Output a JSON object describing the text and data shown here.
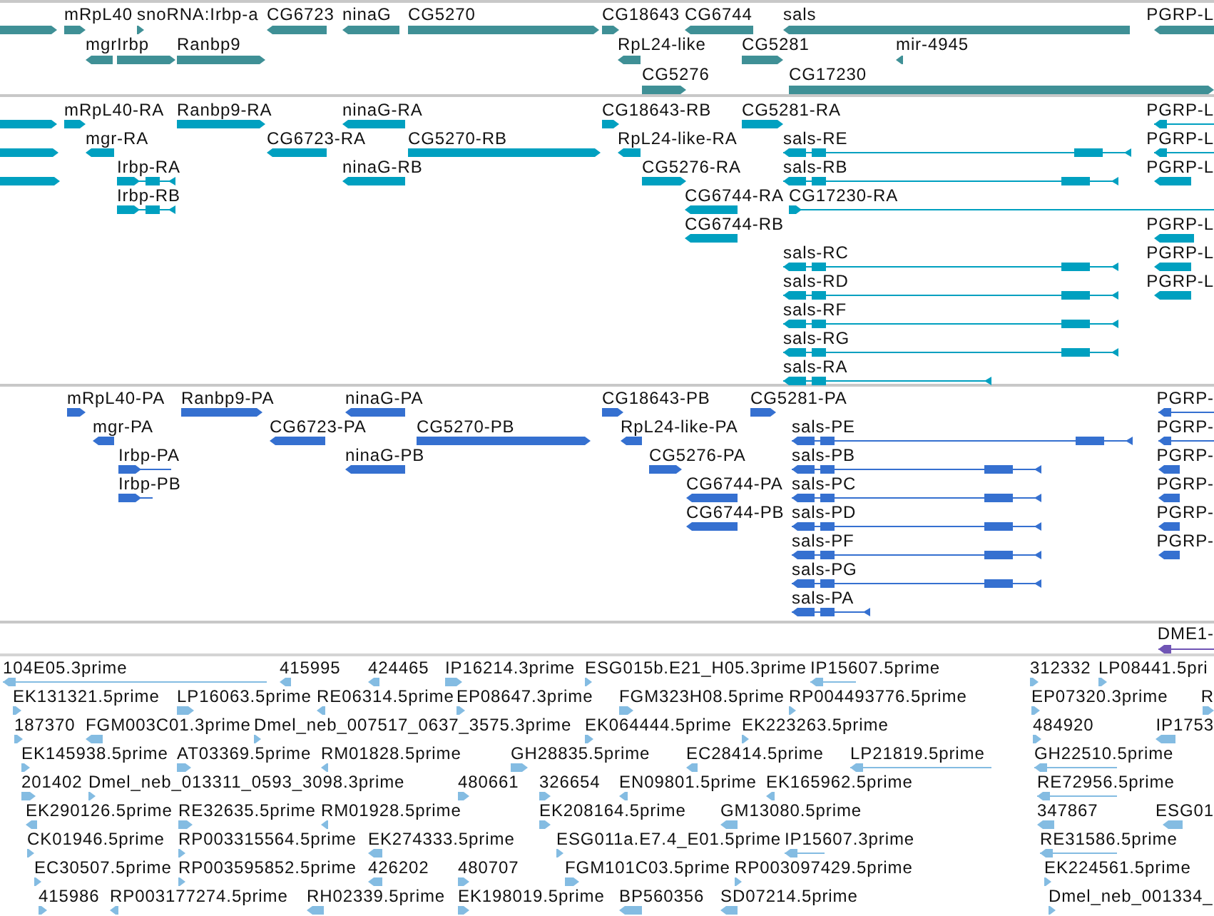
{
  "tracks": [
    {
      "kind": "gene",
      "features": [
        {
          "reverse": false
        },
        {
          "label": "mRpL40",
          "reverse": false
        },
        {
          "label": "snoRNA:Irbp-a",
          "reverse": false
        },
        {
          "label": "CG6723",
          "reverse": true
        },
        {
          "label": "ninaG",
          "reverse": true
        },
        {
          "label": "CG5270",
          "reverse": false
        },
        {
          "label": "CG18643",
          "reverse": false
        },
        {
          "label": "CG6744",
          "reverse": true
        },
        {
          "label": "sals",
          "reverse": true
        },
        {
          "label": "PGRP-L",
          "reverse": true
        },
        {
          "label": "mgr",
          "reverse": true
        },
        {
          "label": "Irbp",
          "reverse": false
        },
        {
          "label": "Ranbp9",
          "reverse": false
        },
        {
          "label": "RpL24-like",
          "reverse": true
        },
        {
          "label": "CG5281",
          "reverse": false
        },
        {
          "label": "mir-4945",
          "reverse": true
        },
        {
          "label": "CG5276",
          "reverse": false
        },
        {
          "label": "CG17230",
          "reverse": false
        }
      ]
    },
    {
      "kind": "transcript",
      "features": [
        {
          "reverse": false
        },
        {
          "label": "mRpL40-RA",
          "reverse": false
        },
        {
          "label": "Ranbp9-RA",
          "reverse": false
        },
        {
          "label": "ninaG-RA",
          "reverse": true
        },
        {
          "label": "CG18643-RB",
          "reverse": false
        },
        {
          "label": "CG5281-RA",
          "reverse": false
        },
        {
          "label": "PGRP-L",
          "reverse": true
        },
        {
          "reverse": false
        },
        {
          "label": "mgr-RA",
          "reverse": true
        },
        {
          "label": "CG6723-RA",
          "reverse": true
        },
        {
          "label": "CG5270-RB",
          "reverse": false
        },
        {
          "label": "RpL24-like-RA",
          "reverse": true
        },
        {
          "label": "sals-RE",
          "reverse": true
        },
        {
          "label": "PGRP-L",
          "reverse": true
        },
        {
          "reverse": false
        },
        {
          "label": "Irbp-RA",
          "reverse": false
        },
        {
          "label": "ninaG-RB",
          "reverse": true
        },
        {
          "label": "CG5276-RA",
          "reverse": false
        },
        {
          "label": "sals-RB",
          "reverse": true
        },
        {
          "label": "PGRP-L",
          "reverse": true
        },
        {
          "label": "Irbp-RB",
          "reverse": false
        },
        {
          "label": "CG6744-RA",
          "reverse": true
        },
        {
          "label": "CG17230-RA",
          "reverse": false
        },
        {
          "label": "CG6744-RB",
          "reverse": true
        },
        {
          "label": "PGRP-L",
          "reverse": true
        },
        {
          "label": "sals-RC",
          "reverse": true
        },
        {
          "label": "PGRP-L",
          "reverse": true
        },
        {
          "label": "sals-RD",
          "reverse": true
        },
        {
          "label": "PGRP-L",
          "reverse": true
        },
        {
          "label": "sals-RF",
          "reverse": true
        },
        {
          "label": "sals-RG",
          "reverse": true
        },
        {
          "label": "sals-RA",
          "reverse": true
        }
      ]
    },
    {
      "kind": "protein",
      "features": [
        {
          "label": "mRpL40-PA",
          "reverse": false
        },
        {
          "label": "Ranbp9-PA",
          "reverse": false
        },
        {
          "label": "ninaG-PA",
          "reverse": true
        },
        {
          "label": "CG18643-PB",
          "reverse": false
        },
        {
          "label": "CG5281-PA",
          "reverse": false
        },
        {
          "label": "PGRP-",
          "reverse": true
        },
        {
          "label": "mgr-PA",
          "reverse": true
        },
        {
          "label": "CG6723-PA",
          "reverse": true
        },
        {
          "label": "CG5270-PB",
          "reverse": false
        },
        {
          "label": "RpL24-like-PA",
          "reverse": true
        },
        {
          "label": "sals-PE",
          "reverse": true
        },
        {
          "label": "PGRP-",
          "reverse": true
        },
        {
          "label": "Irbp-PA",
          "reverse": false
        },
        {
          "label": "ninaG-PB",
          "reverse": true
        },
        {
          "label": "CG5276-PA",
          "reverse": false
        },
        {
          "label": "sals-PB",
          "reverse": true
        },
        {
          "label": "PGRP-",
          "reverse": true
        },
        {
          "label": "Irbp-PB",
          "reverse": false
        },
        {
          "label": "CG6744-PA",
          "reverse": true
        },
        {
          "label": "sals-PC",
          "reverse": true
        },
        {
          "label": "PGRP-",
          "reverse": true
        },
        {
          "label": "CG6744-PB",
          "reverse": true
        },
        {
          "label": "sals-PD",
          "reverse": true
        },
        {
          "label": "PGRP-",
          "reverse": true
        },
        {
          "label": "sals-PF",
          "reverse": true
        },
        {
          "label": "PGRP-",
          "reverse": true
        },
        {
          "label": "sals-PG",
          "reverse": true
        },
        {
          "label": "sals-PA",
          "reverse": true
        }
      ]
    },
    {
      "kind": "repeat",
      "features": [
        {
          "label": "DME1-",
          "reverse": true
        }
      ]
    },
    {
      "kind": "est",
      "features": [
        {
          "label": "104E05.3prime",
          "reverse": true
        },
        {
          "label": "415995",
          "reverse": true
        },
        {
          "label": "424465",
          "reverse": true
        },
        {
          "label": "IP16214.3prime",
          "reverse": false
        },
        {
          "label": "ESG015b.E21_H05.3prime",
          "reverse": false
        },
        {
          "label": "IP15607.5prime",
          "reverse": true
        },
        {
          "label": "312332",
          "reverse": false
        },
        {
          "label": "LP08441.5pri",
          "reverse": false
        },
        {
          "label": "EK131321.5prime",
          "reverse": false
        },
        {
          "label": "LP16063.5prime",
          "reverse": false
        },
        {
          "label": "RE06314.5prime",
          "reverse": true
        },
        {
          "label": "EP08647.3prime",
          "reverse": false
        },
        {
          "label": "FGM323H08.5prime",
          "reverse": false
        },
        {
          "label": "RP004493776.5prime",
          "reverse": false
        },
        {
          "label": "EP07320.3prime",
          "reverse": false
        },
        {
          "label": "R",
          "reverse": false
        },
        {
          "label": "187370",
          "reverse": false
        },
        {
          "label": "FGM003C01.3prime",
          "reverse": true
        },
        {
          "label": "Dmel_neb_007517_0637_3575.3prime",
          "reverse": false
        },
        {
          "label": "EK064444.5prime",
          "reverse": false
        },
        {
          "label": "EK223263.5prime",
          "reverse": false
        },
        {
          "label": "484920",
          "reverse": false
        },
        {
          "label": "IP1753",
          "reverse": true
        },
        {
          "label": "EK145938.5prime",
          "reverse": false
        },
        {
          "label": "AT03369.5prime",
          "reverse": false
        },
        {
          "label": "RM01828.5prime",
          "reverse": true
        },
        {
          "label": "GH28835.5prime",
          "reverse": false
        },
        {
          "label": "EC28414.5prime",
          "reverse": true
        },
        {
          "label": "LP21819.5prime",
          "reverse": true
        },
        {
          "label": "GH22510.5prime",
          "reverse": true
        },
        {
          "label": "201402",
          "reverse": false
        },
        {
          "label": "Dmel_neb_013311_0593_3098.3prime",
          "reverse": false
        },
        {
          "label": "480661",
          "reverse": false
        },
        {
          "label": "326654",
          "reverse": false
        },
        {
          "label": "EN09801.5prime",
          "reverse": true
        },
        {
          "label": "EK165962.5prime",
          "reverse": true
        },
        {
          "label": "RE72956.5prime",
          "reverse": true
        },
        {
          "label": "EK290126.5prime",
          "reverse": true
        },
        {
          "label": "RE32635.5prime",
          "reverse": false
        },
        {
          "label": "RM01928.5prime",
          "reverse": true
        },
        {
          "label": "EK208164.5prime",
          "reverse": false
        },
        {
          "label": "GM13080.5prime",
          "reverse": true
        },
        {
          "label": "347867",
          "reverse": true
        },
        {
          "label": "ESG01",
          "reverse": true
        },
        {
          "label": "CK01946.5prime",
          "reverse": false
        },
        {
          "label": "RP003315564.5prime",
          "reverse": false
        },
        {
          "label": "EK274333.5prime",
          "reverse": true
        },
        {
          "label": "ESG011a.E7.4_E01.5prime",
          "reverse": false
        },
        {
          "label": "IP15607.3prime",
          "reverse": true
        },
        {
          "label": "RE31586.5prime",
          "reverse": true
        },
        {
          "label": "EC30507.5prime",
          "reverse": false
        },
        {
          "label": "RP003595852.5prime",
          "reverse": false
        },
        {
          "label": "426202",
          "reverse": true
        },
        {
          "label": "480707",
          "reverse": false
        },
        {
          "label": "FGM101C03.5prime",
          "reverse": false
        },
        {
          "label": "RP003097429.5prime",
          "reverse": false
        },
        {
          "label": "EK224561.5prime",
          "reverse": false
        },
        {
          "label": "415986",
          "reverse": false
        },
        {
          "label": "RP003177274.5prime",
          "reverse": true
        },
        {
          "label": "RH02339.5prime",
          "reverse": true
        },
        {
          "label": "EK198019.5prime",
          "reverse": false
        },
        {
          "label": "BP560356",
          "reverse": true
        },
        {
          "label": "SD07214.5prime",
          "reverse": true
        },
        {
          "label": "Dmel_neb_001334_",
          "reverse": false
        }
      ]
    }
  ]
}
